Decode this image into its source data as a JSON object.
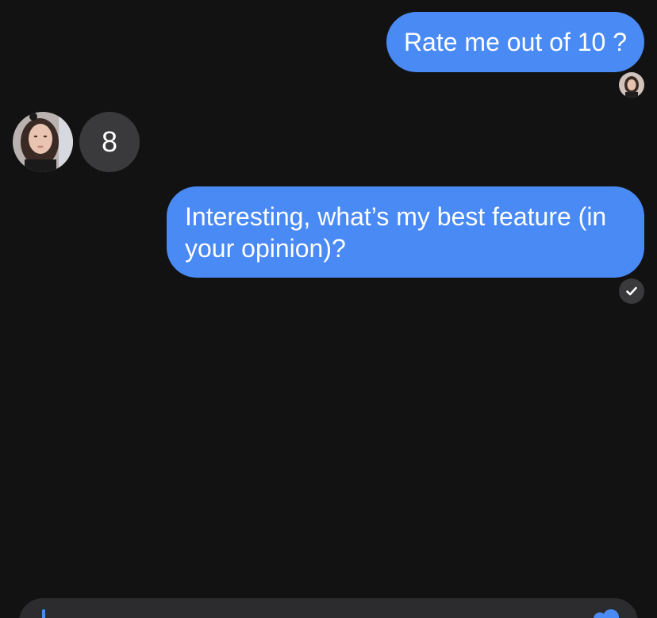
{
  "thread": {
    "messages": [
      {
        "sender": "me",
        "text": "Rate me out of 10 ?"
      },
      {
        "sender": "them",
        "text": "8"
      },
      {
        "sender": "me",
        "text": "Interesting, what’s my best feature (in your opinion)?"
      }
    ],
    "read_receipt_icon": "checkmark-icon"
  },
  "colors": {
    "background": "#121212",
    "sent_bubble": "#4a8af5",
    "received_bubble": "#3a3a3c",
    "composer": "#2c2c2e"
  }
}
